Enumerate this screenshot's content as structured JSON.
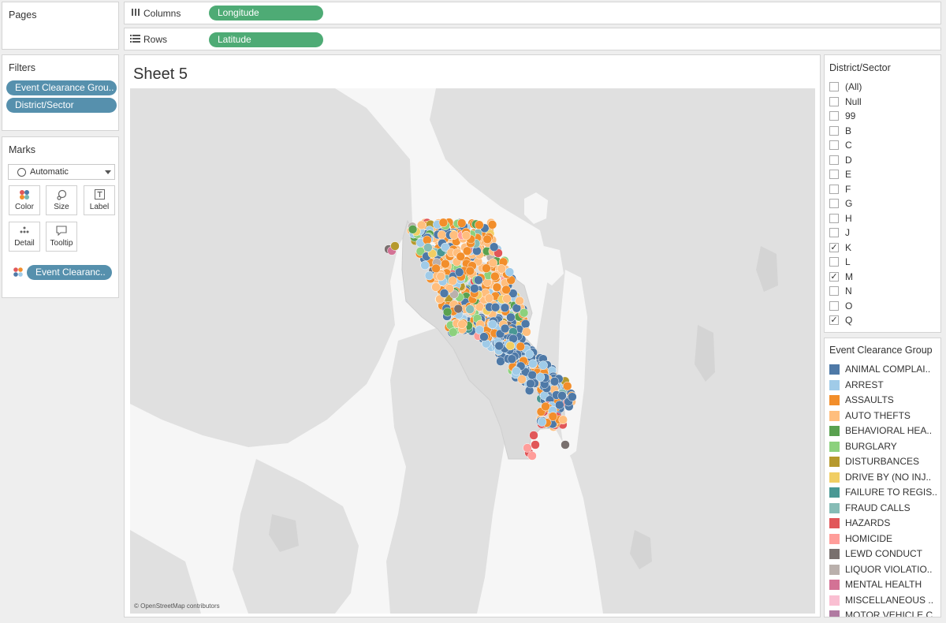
{
  "pages": {
    "title": "Pages"
  },
  "columns": {
    "label": "Columns",
    "pill": "Longitude"
  },
  "rows": {
    "label": "Rows",
    "pill": "Latitude"
  },
  "filters": {
    "title": "Filters",
    "items": [
      "Event Clearance Grou..",
      "District/Sector"
    ]
  },
  "marks": {
    "title": "Marks",
    "type": "Automatic",
    "buttons": [
      "Color",
      "Size",
      "Label",
      "Detail",
      "Tooltip"
    ],
    "color_pill": "Event Clearanc.."
  },
  "sheet": {
    "title": "Sheet 5",
    "attribution": "© OpenStreetMap contributors"
  },
  "district_filter": {
    "title": "District/Sector",
    "items": [
      {
        "label": "(All)",
        "checked": false
      },
      {
        "label": "Null",
        "checked": false
      },
      {
        "label": "99",
        "checked": false
      },
      {
        "label": "B",
        "checked": false
      },
      {
        "label": "C",
        "checked": false
      },
      {
        "label": "D",
        "checked": false
      },
      {
        "label": "E",
        "checked": false
      },
      {
        "label": "F",
        "checked": false
      },
      {
        "label": "G",
        "checked": false
      },
      {
        "label": "H",
        "checked": false
      },
      {
        "label": "J",
        "checked": false
      },
      {
        "label": "K",
        "checked": true
      },
      {
        "label": "L",
        "checked": false
      },
      {
        "label": "M",
        "checked": true
      },
      {
        "label": "N",
        "checked": false
      },
      {
        "label": "O",
        "checked": false
      },
      {
        "label": "Q",
        "checked": true
      }
    ],
    "check_glyph": "✓"
  },
  "legend": {
    "title": "Event Clearance Group",
    "items": [
      {
        "label": "ANIMAL COMPLAI..",
        "color": "#4e79a7"
      },
      {
        "label": "ARREST",
        "color": "#a0cbe8"
      },
      {
        "label": "ASSAULTS",
        "color": "#f28e2b"
      },
      {
        "label": "AUTO THEFTS",
        "color": "#ffbe7d"
      },
      {
        "label": "BEHAVIORAL HEA..",
        "color": "#59a14f"
      },
      {
        "label": "BURGLARY",
        "color": "#8cd17d"
      },
      {
        "label": "DISTURBANCES",
        "color": "#b6992d"
      },
      {
        "label": "DRIVE BY (NO INJ..",
        "color": "#f1ce63"
      },
      {
        "label": "FAILURE TO REGIS..",
        "color": "#499894"
      },
      {
        "label": "FRAUD CALLS",
        "color": "#86bcb6"
      },
      {
        "label": "HAZARDS",
        "color": "#e15759"
      },
      {
        "label": "HOMICIDE",
        "color": "#ff9d9a"
      },
      {
        "label": "LEWD CONDUCT",
        "color": "#79706e"
      },
      {
        "label": "LIQUOR VIOLATIO..",
        "color": "#bab0ac"
      },
      {
        "label": "MENTAL HEALTH",
        "color": "#d37295"
      },
      {
        "label": "MISCELLANEOUS ..",
        "color": "#fabfd2"
      },
      {
        "label": "MOTOR VEHICLE C..",
        "color": "#b07aa1"
      }
    ]
  },
  "colors": {
    "map_land": "#e0e0e0",
    "map_water": "#f6f6f6"
  }
}
